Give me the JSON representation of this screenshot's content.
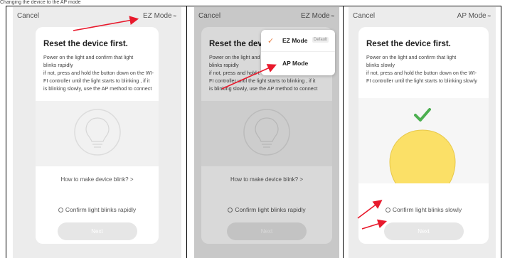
{
  "caption": "Changing the device to the AP mode",
  "panel1": {
    "cancel": "Cancel",
    "mode": "EZ Mode",
    "title": "Reset the device first.",
    "desc": [
      "Power on the light and confirm that light",
      "blinks rapidly",
      "if not, press and hold the button down on the WI-",
      "FI controller until the light starts to blinking , if it",
      "is blinking slowly, use the AP method to connect"
    ],
    "howto": "How to make device blink? >",
    "confirm": "Confirm light blinks rapidly",
    "next": "Next"
  },
  "panel2": {
    "cancel": "Cancel",
    "mode": "EZ Mode",
    "title": "Reset the devic",
    "desc": [
      "Power on the light and",
      "blinks rapidly",
      "if not, press and hold t",
      "FI controller until the light starts to blinking , if it",
      "is blinking slowly, use the AP method to connect"
    ],
    "howto": "How to make device blink? >",
    "confirm": "Confirm light blinks rapidly",
    "next": "Next",
    "menu": {
      "item1": "EZ Mode",
      "item1_badge": "Default",
      "item2": "AP Mode"
    }
  },
  "panel3": {
    "cancel": "Cancel",
    "mode": "AP Mode",
    "title": "Reset the device first.",
    "desc": [
      "Power on the light and confirm that light",
      "blinks slowly",
      "if not, press and hold the button down on the WI-",
      "FI controller until the light starts to blinking slowly"
    ],
    "confirm": "Confirm light blinks slowly",
    "next": "Next"
  },
  "colors": {
    "arrow": "#e8192c",
    "check": "#4caf50",
    "bulb": "#fbe067",
    "menu_check": "#e8834a"
  }
}
